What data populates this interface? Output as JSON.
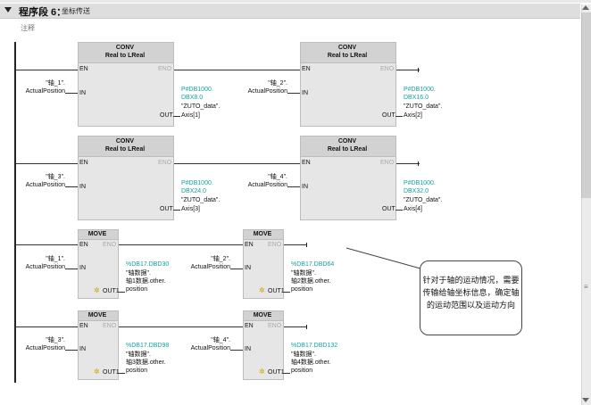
{
  "network": {
    "title": "程序段 6：",
    "name": "坐标传送",
    "comment_label": "注释"
  },
  "conv_blocks": [
    {
      "title1": "CONV",
      "title2": "Real to LReal",
      "en": "EN",
      "eno": "ENO",
      "in": "IN",
      "out": "OUT",
      "in_tag": "\"轴_1\".",
      "in_member": "ActualPosition",
      "out_addr1": "P#DB1000.",
      "out_addr2": "DBX8.0",
      "out_tag": "\"ZUTO_data\".",
      "out_member": "Axis[1]"
    },
    {
      "title1": "CONV",
      "title2": "Real to LReal",
      "en": "EN",
      "eno": "ENO",
      "in": "IN",
      "out": "OUT",
      "in_tag": "\"轴_2\".",
      "in_member": "ActualPosition",
      "out_addr1": "P#DB1000.",
      "out_addr2": "DBX16.0",
      "out_tag": "\"ZUTO_data\".",
      "out_member": "Axis[2]"
    },
    {
      "title1": "CONV",
      "title2": "Real to LReal",
      "en": "EN",
      "eno": "ENO",
      "in": "IN",
      "out": "OUT",
      "in_tag": "\"轴_3\".",
      "in_member": "ActualPosition",
      "out_addr1": "P#DB1000.",
      "out_addr2": "DBX24.0",
      "out_tag": "\"ZUTO_data\".",
      "out_member": "Axis[3]"
    },
    {
      "title1": "CONV",
      "title2": "Real to LReal",
      "en": "EN",
      "eno": "ENO",
      "in": "IN",
      "out": "OUT",
      "in_tag": "\"轴_4\".",
      "in_member": "ActualPosition",
      "out_addr1": "P#DB1000.",
      "out_addr2": "DBX32.0",
      "out_tag": "\"ZUTO_data\".",
      "out_member": "Axis[4]"
    }
  ],
  "move_blocks": [
    {
      "title": "MOVE",
      "en": "EN",
      "eno": "ENO",
      "in": "IN",
      "out": "OUT1",
      "in_tag": "\"轴_1\".",
      "in_member": "ActualPosition",
      "out_addr": "%DB17.DBD30",
      "out_tag": "\"轴数据\".",
      "out_member1": "轴1数据.other.",
      "out_member2": "position"
    },
    {
      "title": "MOVE",
      "en": "EN",
      "eno": "ENO",
      "in": "IN",
      "out": "OUT1",
      "in_tag": "\"轴_2\".",
      "in_member": "ActualPosition",
      "out_addr": "%DB17.DBD64",
      "out_tag": "\"轴数据\".",
      "out_member1": "轴2数据.other.",
      "out_member2": "position"
    },
    {
      "title": "MOVE",
      "en": "EN",
      "eno": "ENO",
      "in": "IN",
      "out": "OUT1",
      "in_tag": "\"轴_3\".",
      "in_member": "ActualPosition",
      "out_addr": "%DB17.DBD98",
      "out_tag": "\"轴数据\".",
      "out_member1": "轴3数据.other.",
      "out_member2": "position"
    },
    {
      "title": "MOVE",
      "en": "EN",
      "eno": "ENO",
      "in": "IN",
      "out": "OUT1",
      "in_tag": "\"轴_4\".",
      "in_member": "ActualPosition",
      "out_addr": "%DB17.DBD132",
      "out_tag": "\"轴数据\".",
      "out_member1": "轴4数据.other.",
      "out_member2": "position"
    }
  ],
  "callout": {
    "line1": "针对于轴的运动情况，需要",
    "line2": "传输给轴坐标信息，确定轴",
    "line3": "的运动范围以及运动方向"
  },
  "colors": {
    "address_teal": "#13a0a0",
    "block_fill": "#e6e6e6"
  }
}
